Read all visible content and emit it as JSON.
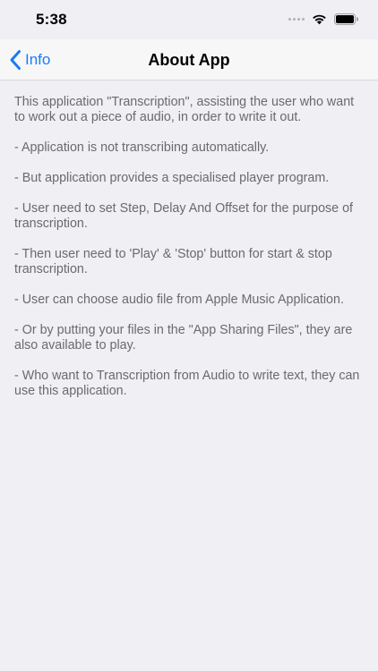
{
  "status_bar": {
    "time": "5:38",
    "signal_icon": "signal-dots-icon",
    "wifi_icon": "wifi-icon",
    "battery_icon": "battery-icon"
  },
  "nav": {
    "back_label": "Info",
    "back_icon": "chevron-left-icon",
    "title": "About App",
    "accent_color": "#1a7cf5"
  },
  "content": {
    "paragraphs": [
      "This application \"Transcription\", assisting the user who want to work out a piece of audio, in order to write it out.",
      "- Application is not transcribing automatically.",
      "- But application provides a specialised player program.",
      "- User need to set Step, Delay And Offset for the purpose of transcription.",
      "- Then user need to 'Play' & 'Stop' button for start & stop transcription.",
      "- User can choose audio file from Apple Music Application.",
      "- Or by putting your files in the \"App Sharing Files\", they are also available to play.",
      "- Who want to Transcription from Audio to write text, they can use this application."
    ]
  }
}
